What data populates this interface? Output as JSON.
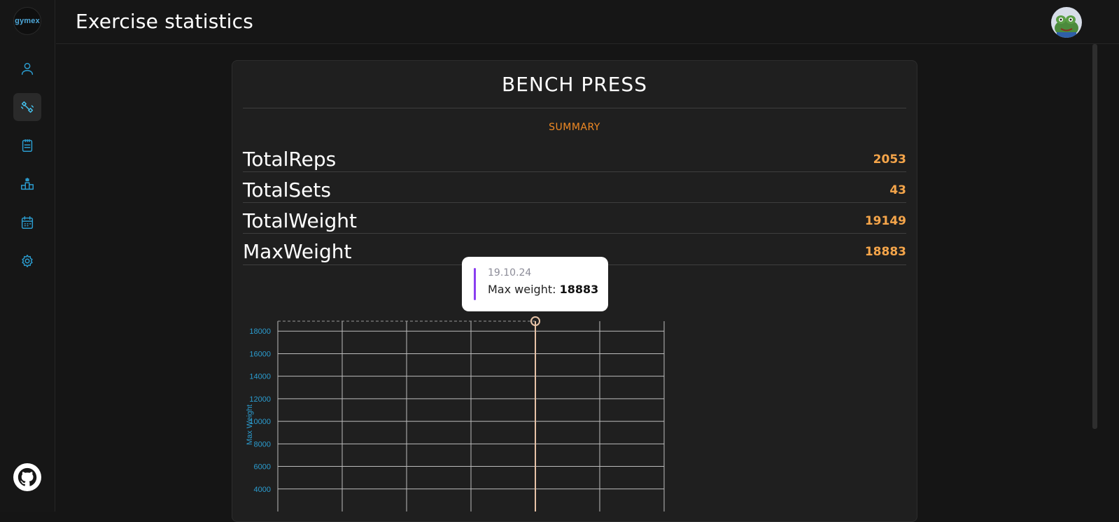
{
  "app": {
    "logo_text": "gymex"
  },
  "header": {
    "title": "Exercise statistics"
  },
  "sidebar": {
    "items": [
      {
        "name": "profile",
        "icon": "user-icon",
        "active": false
      },
      {
        "name": "exercises",
        "icon": "dumbbell-icon",
        "active": true
      },
      {
        "name": "workouts",
        "icon": "clipboard-icon",
        "active": false
      },
      {
        "name": "leaderboard",
        "icon": "podium-icon",
        "active": false
      },
      {
        "name": "calendar",
        "icon": "calendar-icon",
        "active": false
      },
      {
        "name": "settings",
        "icon": "gear-icon",
        "active": false
      }
    ],
    "footer_icon": "github-icon"
  },
  "exercise": {
    "name": "BENCH PRESS",
    "summary_label": "SUMMARY",
    "stats": [
      {
        "label": "TotalReps",
        "value": "2053"
      },
      {
        "label": "TotalSets",
        "value": "43"
      },
      {
        "label": "TotalWeight",
        "value": "19149"
      },
      {
        "label": "MaxWeight",
        "value": "18883"
      }
    ]
  },
  "tooltip": {
    "date": "19.10.24",
    "label": "Max weight:",
    "value": "18883"
  },
  "colors": {
    "accent_orange": "#f08a24",
    "value_orange": "#f5a54a",
    "axis_blue": "#2b9ccf",
    "tooltip_marker": "#8a3ef0",
    "highlight_line": "#e8c4a8"
  },
  "chart_data": {
    "type": "line",
    "ylabel": "Max Weight",
    "yticks": [
      4000,
      6000,
      8000,
      10000,
      12000,
      14000,
      16000,
      18000
    ],
    "ylim": [
      2000,
      18883
    ],
    "x_gridlines": 7,
    "highlight": {
      "date": "19.10.24",
      "value": 18883,
      "index": 4
    },
    "grid": true
  }
}
